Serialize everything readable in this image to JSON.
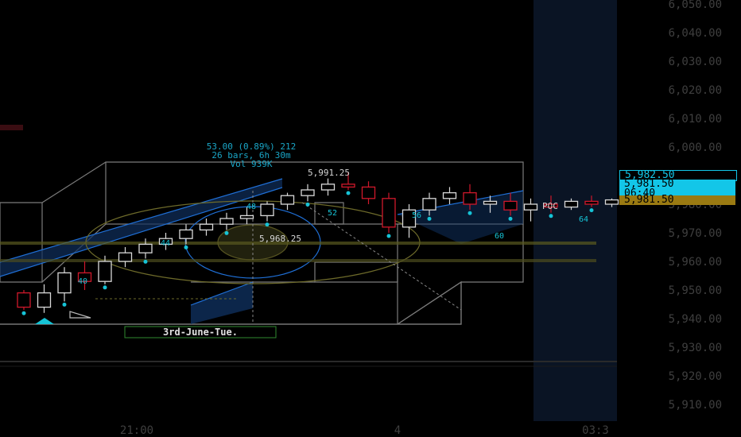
{
  "colors": {
    "background": "#000000",
    "up_candle": "#d9d9d9",
    "down_candle": "#d0182b",
    "box_edge": "#7b7b7b",
    "blue_band": "#1f6fd6",
    "cyan_marker": "#16c3d6",
    "yellow_line": "#8a8a3a",
    "session_shade": "#0a1424",
    "tag_cyan": "#13c6e8",
    "tag_gold": "#9a7a12"
  },
  "price_axis": {
    "labels": [
      "6,050.00",
      "6,040.00",
      "6,030.00",
      "6,020.00",
      "6,010.00",
      "6,000.00",
      "5,980.00",
      "5,970.00",
      "5,960.00",
      "5,950.00",
      "5,940.00",
      "5,930.00",
      "5,920.00",
      "5,910.00"
    ],
    "tags": {
      "outline": "5,982.50",
      "current": "5,981.50",
      "countdown": "06:40",
      "gold": "5,981.50"
    }
  },
  "time_axis": {
    "labels": [
      "21:00",
      "4",
      "03:3"
    ]
  },
  "annotations": {
    "measure_line1": "53.00 (0.89%) 212",
    "measure_line2": "26 bars, 6h 30m",
    "measure_line3": "Vol 939K",
    "high_label": "5,991.25",
    "low_label": "5,968.25",
    "poc_label": "POC",
    "session_label": "3rd-June-Tue.",
    "bar_numbers": [
      "40",
      "44",
      "48",
      "52",
      "56",
      "60",
      "64"
    ]
  },
  "chart_data": {
    "type": "candlestick",
    "ylim": [
      5905,
      6052
    ],
    "candles": [
      {
        "o": 5949,
        "h": 5950,
        "l": 5943,
        "c": 5944
      },
      {
        "o": 5944,
        "h": 5952,
        "l": 5942,
        "c": 5949
      },
      {
        "o": 5949,
        "h": 5958,
        "l": 5946,
        "c": 5956
      },
      {
        "o": 5956,
        "h": 5960,
        "l": 5950,
        "c": 5953
      },
      {
        "o": 5953,
        "h": 5962,
        "l": 5952,
        "c": 5960
      },
      {
        "o": 5960,
        "h": 5965,
        "l": 5958,
        "c": 5963
      },
      {
        "o": 5963,
        "h": 5968,
        "l": 5961,
        "c": 5966
      },
      {
        "o": 5966,
        "h": 5970,
        "l": 5964,
        "c": 5968
      },
      {
        "o": 5968,
        "h": 5973,
        "l": 5966,
        "c": 5971
      },
      {
        "o": 5971,
        "h": 5975,
        "l": 5969,
        "c": 5973
      },
      {
        "o": 5973,
        "h": 5977,
        "l": 5971,
        "c": 5975
      },
      {
        "o": 5975,
        "h": 5979,
        "l": 5973,
        "c": 5976
      },
      {
        "o": 5976,
        "h": 5981,
        "l": 5974,
        "c": 5980
      },
      {
        "o": 5980,
        "h": 5984,
        "l": 5978,
        "c": 5983
      },
      {
        "o": 5983,
        "h": 5987,
        "l": 5981,
        "c": 5985
      },
      {
        "o": 5985,
        "h": 5989,
        "l": 5983,
        "c": 5987
      },
      {
        "o": 5987,
        "h": 5991.25,
        "l": 5985,
        "c": 5986
      },
      {
        "o": 5986,
        "h": 5988,
        "l": 5980,
        "c": 5982
      },
      {
        "o": 5982,
        "h": 5984,
        "l": 5970,
        "c": 5972
      },
      {
        "o": 5972,
        "h": 5980,
        "l": 5968.25,
        "c": 5978
      },
      {
        "o": 5978,
        "h": 5984,
        "l": 5976,
        "c": 5982
      },
      {
        "o": 5982,
        "h": 5986,
        "l": 5980,
        "c": 5984
      },
      {
        "o": 5984,
        "h": 5987,
        "l": 5978,
        "c": 5980
      },
      {
        "o": 5980,
        "h": 5983,
        "l": 5977,
        "c": 5981
      },
      {
        "o": 5981,
        "h": 5984,
        "l": 5976,
        "c": 5978
      },
      {
        "o": 5978,
        "h": 5982,
        "l": 5974,
        "c": 5980
      },
      {
        "o": 5980,
        "h": 5983,
        "l": 5977,
        "c": 5979
      },
      {
        "o": 5979,
        "h": 5982,
        "l": 5978,
        "c": 5981
      },
      {
        "o": 5981,
        "h": 5983,
        "l": 5979,
        "c": 5980
      },
      {
        "o": 5980,
        "h": 5982,
        "l": 5979,
        "c": 5981.5
      }
    ]
  }
}
